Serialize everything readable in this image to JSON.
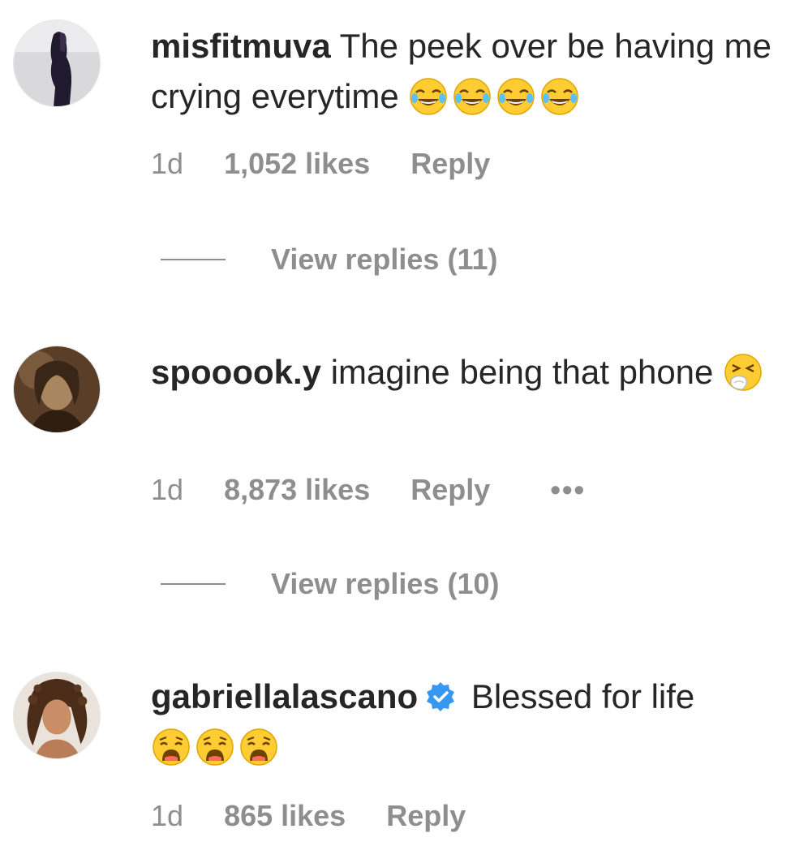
{
  "comments": [
    {
      "username": "misfitmuva",
      "text": "The peek over be having me crying everytime",
      "emoji_icons": [
        "face-with-tears-of-joy-icon",
        "face-with-tears-of-joy-icon",
        "face-with-tears-of-joy-icon",
        "face-with-tears-of-joy-icon"
      ],
      "time": "1d",
      "likes": "1,052 likes",
      "reply": "Reply",
      "view_replies": "View replies (11)",
      "verified": false
    },
    {
      "username": "spooook.y",
      "text": "imagine being that phone",
      "emoji_icons": [
        "sneezing-face-icon"
      ],
      "time": "1d",
      "likes": "8,873 likes",
      "reply": "Reply",
      "more": "•••",
      "view_replies": "View replies (10)",
      "verified": false
    },
    {
      "username": "gabriellalascano",
      "text": "Blessed for life",
      "emoji_icons": [
        "weary-face-icon",
        "weary-face-icon",
        "weary-face-icon"
      ],
      "time": "1d",
      "likes": "865 likes",
      "reply": "Reply",
      "verified": true
    }
  ],
  "colors": {
    "text": "#262626",
    "secondary": "#8e8e8e",
    "verified_blue": "#3897f0",
    "emoji_yellow": "#ffcc33"
  }
}
